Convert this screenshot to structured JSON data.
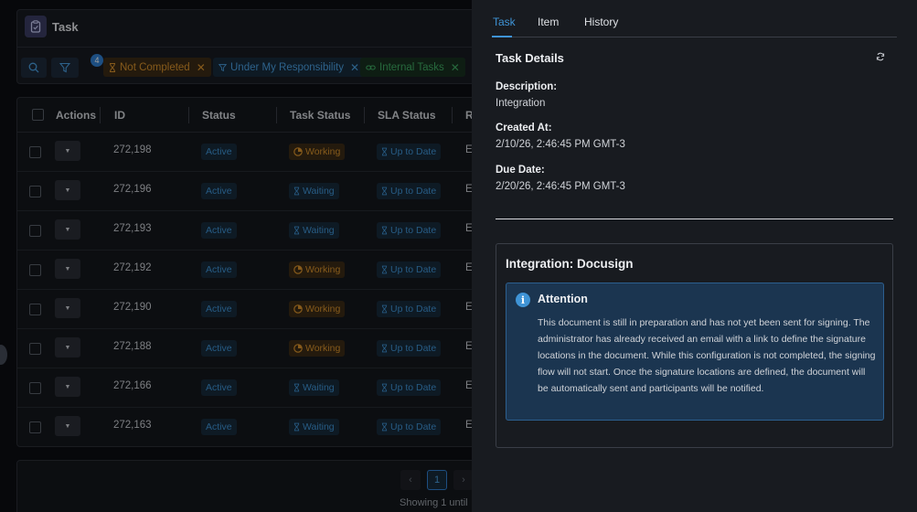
{
  "app": {
    "title": "Task",
    "filter_count": "4",
    "chips": [
      {
        "label": "Not Completed",
        "color": "#d9922c"
      },
      {
        "label": "Under My Responsibility",
        "color": "#4a9fe0"
      },
      {
        "label": "Internal Tasks",
        "color": "#3faa63"
      }
    ]
  },
  "table": {
    "columns": [
      "Actions",
      "ID",
      "Status",
      "Task Status",
      "SLA Status",
      "Re"
    ],
    "rows": [
      {
        "id": "272,198",
        "status": "Active",
        "task_status": "Working",
        "sla": "Up to Date",
        "ev": "Ev"
      },
      {
        "id": "272,196",
        "status": "Active",
        "task_status": "Waiting",
        "sla": "Up to Date",
        "ev": "Ev"
      },
      {
        "id": "272,193",
        "status": "Active",
        "task_status": "Waiting",
        "sla": "Up to Date",
        "ev": "Ev"
      },
      {
        "id": "272,192",
        "status": "Active",
        "task_status": "Working",
        "sla": "Up to Date",
        "ev": "Ev"
      },
      {
        "id": "272,190",
        "status": "Active",
        "task_status": "Working",
        "sla": "Up to Date",
        "ev": "Ev"
      },
      {
        "id": "272,188",
        "status": "Active",
        "task_status": "Working",
        "sla": "Up to Date",
        "ev": "Ev"
      },
      {
        "id": "272,166",
        "status": "Active",
        "task_status": "Waiting",
        "sla": "Up to Date",
        "ev": "Ev"
      },
      {
        "id": "272,163",
        "status": "Active",
        "task_status": "Waiting",
        "sla": "Up to Date",
        "ev": "Ev"
      }
    ]
  },
  "pager": {
    "prev": "‹",
    "current_page": "1",
    "next": "›",
    "showing_text": "Showing 1 until"
  },
  "drawer": {
    "tabs": [
      "Task",
      "Item",
      "History"
    ],
    "active_tab": "Task",
    "section_title": "Task Details",
    "description_label": "Description:",
    "description_value": "Integration",
    "created_label": "Created At:",
    "created_value": "2/10/26, 2:46:45 PM GMT-3",
    "due_label": "Due Date:",
    "due_value": "2/20/26, 2:46:45 PM GMT-3",
    "integration_title": "Integration: Docusign",
    "alert": {
      "icon": "i",
      "title": "Attention",
      "body": "This document is still in preparation and has not yet been sent for signing. The administrator has already received an email with a link to define the signature locations in the document. While this configuration is not completed, the signing flow will not start. Once the signature locations are defined, the document will be automatically sent and participants will be notified."
    }
  },
  "colors": {
    "accent": "#3f94d6",
    "working": "#d9922c",
    "internal": "#3faa63"
  }
}
